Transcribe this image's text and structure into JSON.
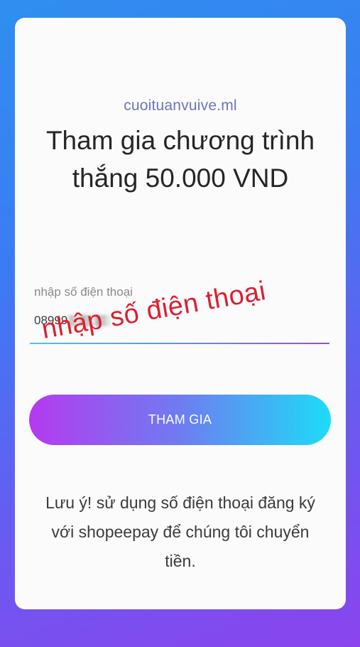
{
  "card": {
    "site": "cuoituanvuive.ml",
    "headline": "Tham gia chương trình thắng 50.000 VND"
  },
  "form": {
    "phone_label": "nhập số điện thoại",
    "phone_value_visible": "08999"
  },
  "overlay": {
    "annotation_text": "nhập số điện thoại",
    "annotation_color": "#dd1f2f"
  },
  "button": {
    "join_label": "THAM GIA"
  },
  "note": {
    "text": "Lưu ý! sử dụng số điện thoại đăng ký với shopeepay để chúng tôi chuyển tiền."
  }
}
